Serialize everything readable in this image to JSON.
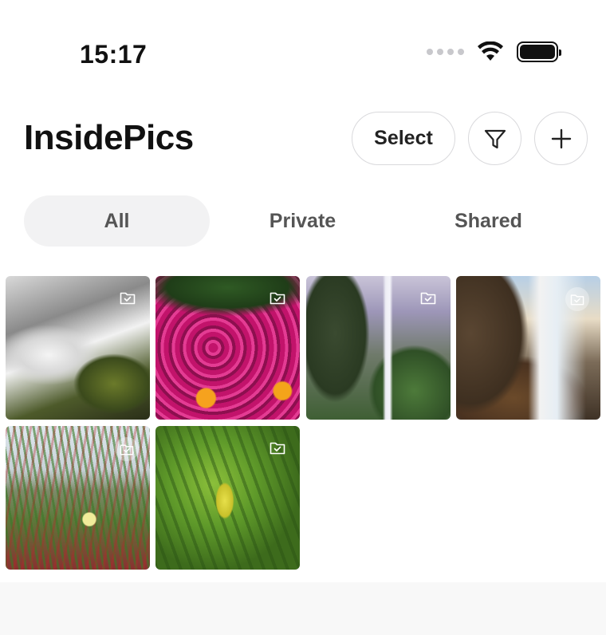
{
  "status_bar": {
    "time": "15:17",
    "icons": [
      "signal-dots-icon",
      "wifi-icon",
      "battery-icon"
    ]
  },
  "header": {
    "title": "InsidePics",
    "select_label": "Select",
    "filter_icon": "funnel-icon",
    "add_icon": "plus-icon"
  },
  "tabs": [
    {
      "label": "All",
      "active": true
    },
    {
      "label": "Private",
      "active": false
    },
    {
      "label": "Shared",
      "active": false
    }
  ],
  "photos": [
    {
      "subject": "waterfall-rocks",
      "badge_icon": "folder-check-icon"
    },
    {
      "subject": "magenta-flowers",
      "badge_icon": "folder-check-icon"
    },
    {
      "subject": "misty-waterfall",
      "badge_icon": "folder-check-icon"
    },
    {
      "subject": "cliff-waterfall",
      "badge_icon": "folder-check-icon"
    },
    {
      "subject": "coastal-grass",
      "badge_icon": "folder-check-icon"
    },
    {
      "subject": "green-leaves",
      "badge_icon": "folder-check-icon"
    }
  ],
  "colors": {
    "background": "#ffffff",
    "text": "#111111",
    "tab_active_bg": "#f2f2f3",
    "button_border": "#d9d9dc"
  }
}
